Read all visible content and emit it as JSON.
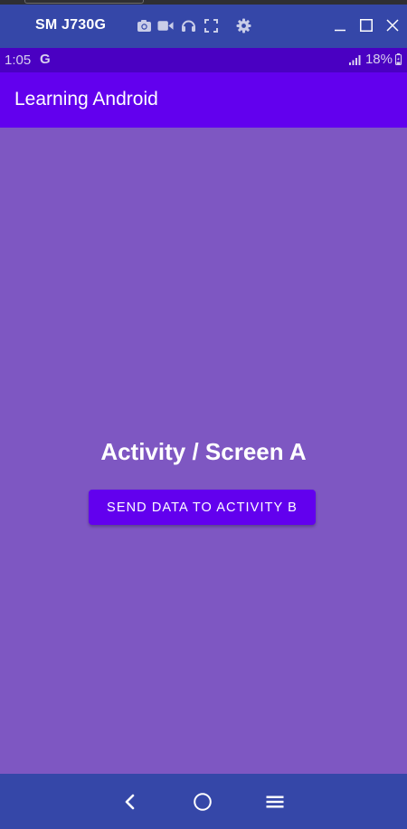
{
  "window": {
    "device_name": "SM J730G",
    "toolbar_icons": [
      "camera-icon",
      "video-icon",
      "headphones-icon",
      "fullscreen-icon",
      "settings-icon"
    ],
    "window_controls": [
      "minimize-icon",
      "maximize-icon",
      "close-icon"
    ]
  },
  "status_bar": {
    "time": "1:05",
    "google_badge": "G",
    "battery": "18%"
  },
  "app_bar": {
    "title": "Learning Android"
  },
  "main": {
    "screen_title": "Activity / Screen A",
    "send_button_label": "SEND DATA TO ACTIVITY B"
  },
  "nav_bar": {
    "buttons": [
      "back-icon",
      "home-icon",
      "recents-icon"
    ]
  },
  "colors": {
    "host_bar": "#3547a8",
    "status_bar": "#4a00c2",
    "app_bar": "#6200ee",
    "content_background": "#7e57c2",
    "button": "#6200ee",
    "text": "#ffffff"
  }
}
